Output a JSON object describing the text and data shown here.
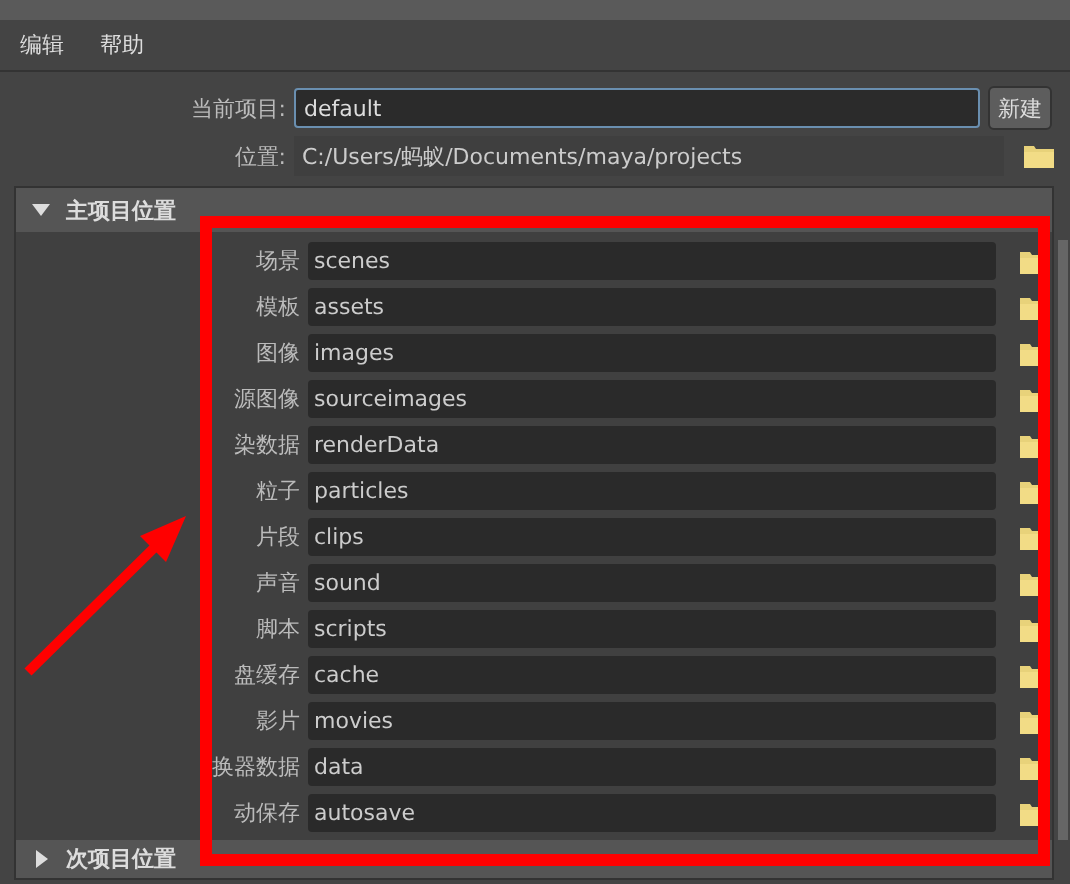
{
  "menu": [
    "编辑",
    "帮助"
  ],
  "current_project": {
    "label": "当前项目:",
    "value": "default",
    "button": "新建"
  },
  "location": {
    "label": "位置:",
    "value": "C:/Users/蚂蚁/Documents/maya/projects"
  },
  "primary_section": {
    "title": "主项目位置",
    "expanded": true,
    "rows": [
      {
        "label": "场景",
        "value": "scenes"
      },
      {
        "label": "模板",
        "value": "assets"
      },
      {
        "label": "图像",
        "value": "images"
      },
      {
        "label": "源图像",
        "value": "sourceimages"
      },
      {
        "label": "染数据",
        "value": "renderData"
      },
      {
        "label": "粒子",
        "value": "particles"
      },
      {
        "label": "片段",
        "value": "clips"
      },
      {
        "label": "声音",
        "value": "sound"
      },
      {
        "label": "脚本",
        "value": "scripts"
      },
      {
        "label": "盘缓存",
        "value": "cache"
      },
      {
        "label": "影片",
        "value": "movies"
      },
      {
        "label": "换器数据",
        "value": "data"
      },
      {
        "label": "动保存",
        "value": "autosave"
      }
    ]
  },
  "secondary_section": {
    "title": "次项目位置",
    "expanded": false
  }
}
